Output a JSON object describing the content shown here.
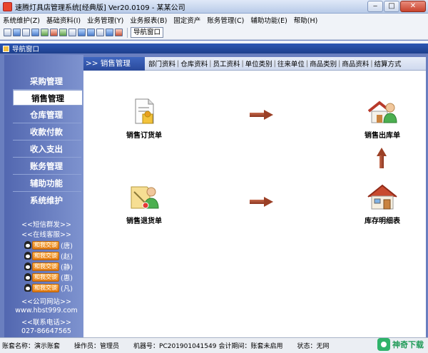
{
  "window": {
    "title": "速腾灯具店管理系统[经典版] Ver20.0109 - 某某公司",
    "minimize": "‒",
    "maximize": "□",
    "close": "✕"
  },
  "menubar": [
    "系统维护(Z)",
    "基础资料(I)",
    "业务管理(Y)",
    "业务报表(B)",
    "固定资产",
    "账务管理(C)",
    "辅助功能(E)",
    "帮助(H)"
  ],
  "toolbar": {
    "nav_window_label": "导航窗口"
  },
  "child_window": {
    "title": "导航窗口"
  },
  "sidebar": {
    "items": [
      "采购管理",
      "销售管理",
      "仓库管理",
      "收款付款",
      "收入支出",
      "账务管理",
      "辅助功能",
      "系统维护"
    ],
    "active_index": 1,
    "sms": "<<短信群发>>",
    "online_service": "<<在线客服>>",
    "qq_badge": "和我交谈",
    "qq_names": [
      "(唐)",
      "(赵)",
      "(静)",
      "(惠)",
      "(凡)"
    ],
    "company_site_label": "<<公司网站>>",
    "website": "www.hbst999.com",
    "contact_label": "<<联系电话>>",
    "phone": "027-86647565"
  },
  "breadcrumb": {
    "title": ">> 销售管理",
    "links": [
      "部门资料",
      "仓库资料",
      "员工资料",
      "单位类别",
      "往来单位",
      "商品类别",
      "商品资料",
      "结算方式"
    ],
    "separator": "|"
  },
  "flow": {
    "sales_order": "销售订货单",
    "sales_outbound": "销售出库单",
    "sales_return": "销售退货单",
    "inventory_detail": "库存明细表"
  },
  "status": {
    "account_set": "账套名称：演示账套",
    "operator": "操作员：管理员",
    "machine_no": "机器号：PC20190104154​9",
    "accounting_period": "会计期间：账套未启用",
    "state": "状态：无网"
  },
  "watermark": {
    "text": "神奇下载"
  },
  "colors": {
    "sidebar": "#6a7fbf",
    "accent_blue": "#2a4a9b",
    "arrow": "#9b4026"
  }
}
